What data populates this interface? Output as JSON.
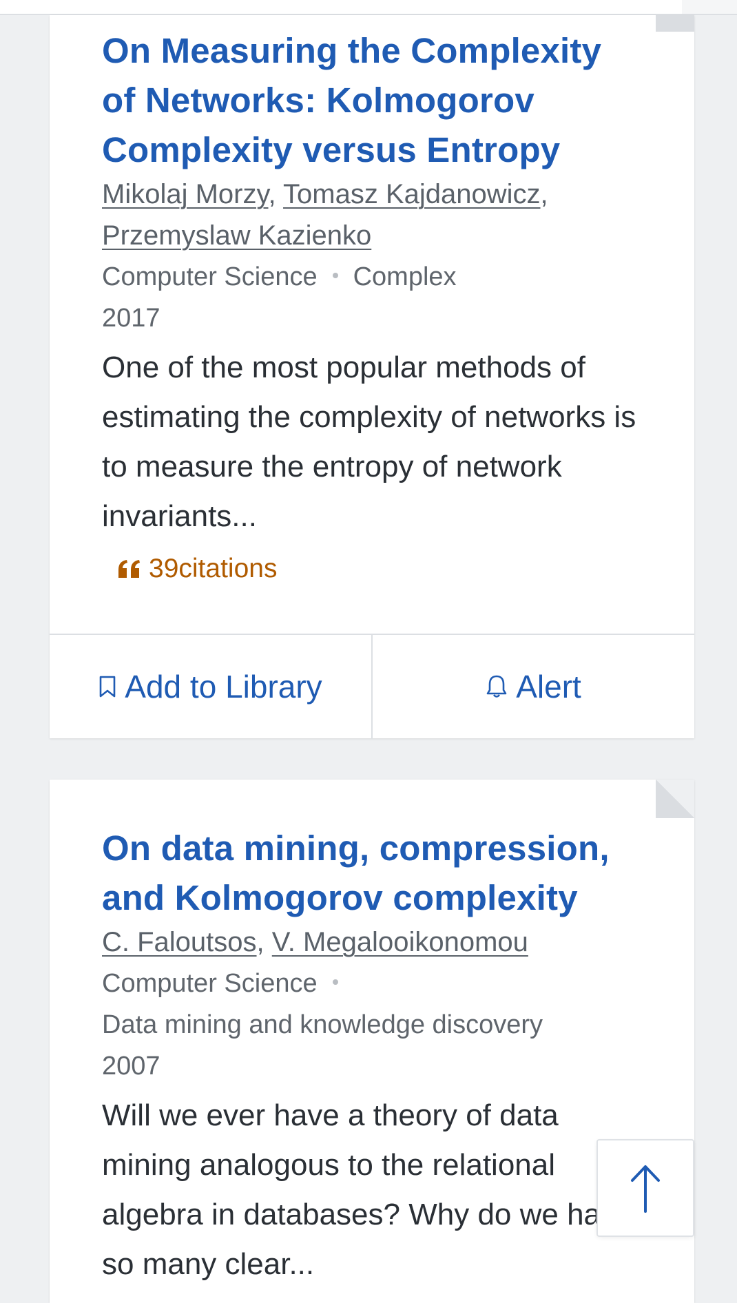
{
  "results": [
    {
      "title": "On Measuring the Complexity of Networks: Kolmogorov Complexity versus Entropy",
      "authors": [
        "Mikolaj Morzy",
        "Tomasz Kajdanowicz",
        "Przemyslaw Kazienko"
      ],
      "field": "Computer Science",
      "venue": "Complex",
      "year": "2017",
      "abstract": "One of the most popular methods of estimating the complexity of networks is to measure the entropy of network invariants...",
      "citations": "39citations",
      "actions": {
        "add_to_library": "Add to Library",
        "alert": "Alert"
      }
    },
    {
      "title": "On data mining, compression, and Kolmogorov complexity",
      "authors": [
        "C. Faloutsos",
        "V. Megalooikonomou"
      ],
      "field": "Computer Science",
      "venue": "Data mining and knowledge discovery",
      "year": "2007",
      "abstract": "Will we ever have a theory of data mining analogous to the relational algebra in databases? Why do we have so many clear..."
    }
  ],
  "colors": {
    "title": "#1f5bb3",
    "meta": "#5f656c",
    "citations": "#b05b00",
    "background": "#eef0f2"
  },
  "icons": {
    "citations": "quote-icon",
    "add_to_library": "bookmark-icon",
    "alert": "bell-icon",
    "back_to_top": "arrow-up-icon"
  }
}
